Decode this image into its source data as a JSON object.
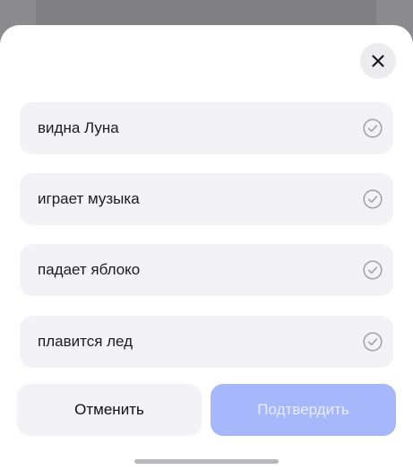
{
  "sheet": {
    "close_icon": "close-icon",
    "options": [
      {
        "label": "видна Луна",
        "icon": "check-circle-icon"
      },
      {
        "label": "играет музыка",
        "icon": "check-circle-icon"
      },
      {
        "label": "падает яблоко",
        "icon": "check-circle-icon"
      },
      {
        "label": "плавится лед",
        "icon": "check-circle-icon"
      }
    ],
    "cancel_label": "Отменить",
    "confirm_label": "Подтвердить"
  },
  "colors": {
    "sheet_background": "#ffffff",
    "option_background": "#f3f3f7",
    "confirm_disabled": "#a6b7fb",
    "check_icon": "#a3a3a8"
  }
}
